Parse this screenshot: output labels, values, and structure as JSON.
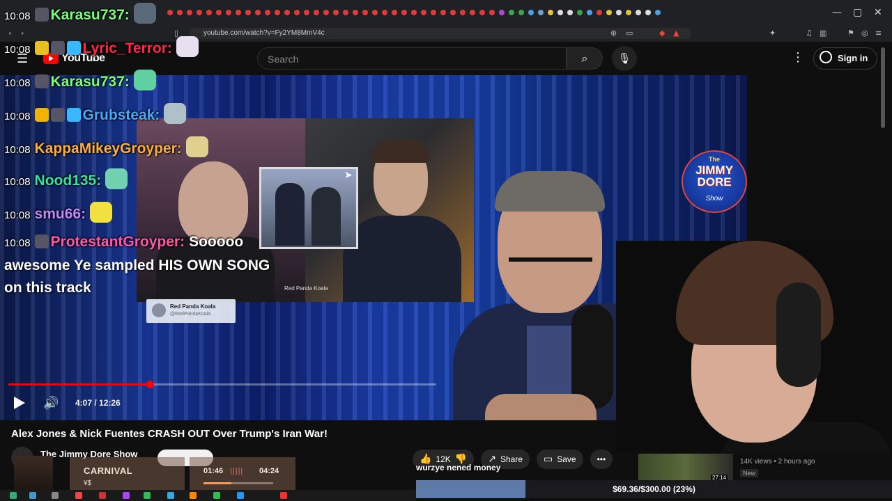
{
  "browser": {
    "url": "youtube.com/watch?v=Fy2YM8MmV4c",
    "tab_dot_colors": [
      "#e03a3a",
      "#e03a3a",
      "#e03a3a",
      "#e03a3a",
      "#e03a3a",
      "#e03a3a",
      "#e03a3a",
      "#e03a3a",
      "#e03a3a",
      "#e03a3a",
      "#e03a3a",
      "#e03a3a",
      "#e03a3a",
      "#e03a3a",
      "#e03a3a",
      "#e03a3a",
      "#e03a3a",
      "#e03a3a",
      "#e03a3a",
      "#e03a3a",
      "#e03a3a",
      "#e03a3a",
      "#e03a3a",
      "#e03a3a",
      "#e03a3a",
      "#e03a3a",
      "#e03a3a",
      "#e03a3a",
      "#e03a3a",
      "#e03a3a",
      "#e03a3a",
      "#e03a3a",
      "#e03a3a",
      "#e03a3a",
      "#b04ad0",
      "#3fa34d",
      "#3fa34d",
      "#4aa0e0",
      "#6aa0d0",
      "#e0c040",
      "#ddd",
      "#ddd",
      "#3fa34d",
      "#4aa0e0",
      "#e03a3a",
      "#e0c040",
      "#ddd",
      "#e0c040",
      "#ddd",
      "#ddd",
      "#4aa0e0"
    ],
    "window_controls": [
      "—",
      "▢",
      "✕"
    ]
  },
  "youtube": {
    "logo_text": "YouTube",
    "search_placeholder": "Search",
    "sign_in": "Sign in",
    "icons": {
      "menu": "☰",
      "search": "⌕",
      "mic": "🎙",
      "more": "⋮",
      "account": "👤"
    }
  },
  "video": {
    "title": "Alex Jones & Nick Fuentes CRASH OUT Over Trump's Iran War!",
    "time": "4:07 / 12:26",
    "progress_fraction": 0.33,
    "channel": "The Jimmy Dore Show",
    "inset_watermark": "Red Panda Koala",
    "credit_name": "Red Panda Koala",
    "credit_handle": "@RedPandaKoala",
    "logo_the": "The",
    "logo_name": "JIMMY DORE",
    "logo_show": "Show"
  },
  "actions": {
    "likes": "12K",
    "share": "Share",
    "save": "Save",
    "more": "•••"
  },
  "recommendation": {
    "meta": "14K views • 2 hours ago",
    "badge": "New",
    "duration": "27:14"
  },
  "chat": {
    "messages": [
      {
        "time": "10:08",
        "user": "Karasu737:",
        "color": "#7cff7c",
        "badges": [
          "#556"
        ],
        "message": "",
        "emote": "#5a6a7a"
      },
      {
        "time": "10:08",
        "user": "Lyric_Terror:",
        "color": "#ff2a4a",
        "badges": [
          "#e6c020",
          "#556",
          "#39b7ff"
        ],
        "message": "",
        "emote": "#e8e0f0"
      },
      {
        "time": "10:08",
        "user": "Karasu737:",
        "color": "#7cff7c",
        "badges": [
          "#556"
        ],
        "message": "",
        "emote": "#60d0a0"
      },
      {
        "time": "10:08",
        "user": "Grubsteak:",
        "color": "#4aa8ff",
        "badges": [
          "#f0b400",
          "#556",
          "#39b7ff"
        ],
        "message": "",
        "emote": "#b0c0c8"
      },
      {
        "time": "10:08",
        "user": "KappaMikeyGroyper:",
        "color": "#ffae42",
        "badges": [],
        "message": "",
        "emote": "#e0d090"
      },
      {
        "time": "10:08",
        "user": "Nood135:",
        "color": "#3ce0a0",
        "badges": [],
        "message": "",
        "emote": "#70d0b0"
      },
      {
        "time": "10:08",
        "user": "smu66:",
        "color": "#c08aff",
        "badges": [],
        "message": "",
        "emote": "#f0e040"
      },
      {
        "time": "10:08",
        "user": "ProtestantGroyper:",
        "color": "#ff5aa8",
        "badges": [
          "#556"
        ],
        "message": "Sooooo",
        "emote": ""
      }
    ],
    "wrap_text": "awesome Ye sampled HIS OWN SONG on this track",
    "overlay_caption": "wurzye nened money"
  },
  "spotify": {
    "title": "CARNIVAL",
    "artist": "¥$",
    "elapsed": "01:46",
    "total": "04:24",
    "progress_fraction": 0.4
  },
  "donation": {
    "text": "$69.36/$300.00 (23%)",
    "fraction": 0.23,
    "fill_color": "#5c7ba8"
  }
}
